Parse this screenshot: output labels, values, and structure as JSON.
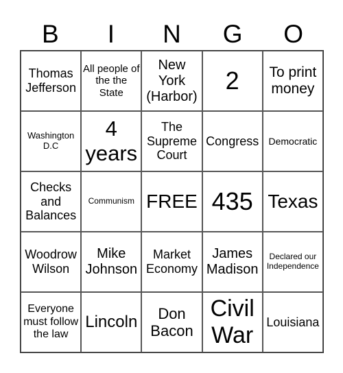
{
  "header": [
    "B",
    "I",
    "N",
    "G",
    "O"
  ],
  "cells": [
    {
      "text": "Thomas Jefferson",
      "size": 18
    },
    {
      "text": "All people of the the State",
      "size": 15
    },
    {
      "text": "New York (Harbor)",
      "size": 20
    },
    {
      "text": "2",
      "size": 36
    },
    {
      "text": "To print money",
      "size": 21
    },
    {
      "text": "Washington D.C",
      "size": 13
    },
    {
      "text": "4 years",
      "size": 31
    },
    {
      "text": "The Supreme Court",
      "size": 18
    },
    {
      "text": "Congress",
      "size": 18
    },
    {
      "text": "Democratic",
      "size": 14
    },
    {
      "text": "Checks and Balances",
      "size": 18
    },
    {
      "text": "Communism",
      "size": 12
    },
    {
      "text": "FREE",
      "size": 28
    },
    {
      "text": "435",
      "size": 36
    },
    {
      "text": "Texas",
      "size": 28
    },
    {
      "text": "Woodrow Wilson",
      "size": 18
    },
    {
      "text": "Mike Johnson",
      "size": 20
    },
    {
      "text": "Market Economy",
      "size": 18
    },
    {
      "text": "James Madison",
      "size": 20
    },
    {
      "text": "Declared our Independence",
      "size": 12
    },
    {
      "text": "Everyone must follow the law",
      "size": 16
    },
    {
      "text": "Lincoln",
      "size": 24
    },
    {
      "text": "Don Bacon",
      "size": 22
    },
    {
      "text": "Civil War",
      "size": 34
    },
    {
      "text": "Louisiana",
      "size": 18
    }
  ]
}
